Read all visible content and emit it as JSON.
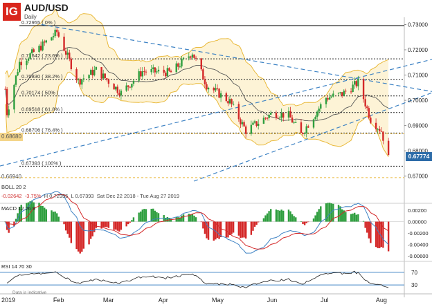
{
  "header": {
    "logo_text": "IG",
    "symbol": "AUD/USD",
    "timeframe": "Daily"
  },
  "price_axis": {
    "ticks": [
      "0.73000",
      "0.72000",
      "0.71000",
      "0.70000",
      "0.69000",
      "0.68000",
      "0.67000"
    ],
    "last_price_tag": "0.67774",
    "left_tags": [
      "0.68680",
      "0.66940"
    ]
  },
  "fib_levels": [
    {
      "label": "0.72955 ( 0% )",
      "price": 0.72955
    },
    {
      "label": "0.71642 ( 23.6% )",
      "price": 0.71642
    },
    {
      "label": "0.70830 ( 38.2% )",
      "price": 0.7083
    },
    {
      "label": "0.70174 ( 50% )",
      "price": 0.70174
    },
    {
      "label": "0.69518 ( 61.8% )",
      "price": 0.69518
    },
    {
      "label": "0.68706 ( 76.4% )",
      "price": 0.68706
    },
    {
      "label": "0.67393 ( 100% )",
      "price": 0.67393
    }
  ],
  "info_bar": {
    "boll": "BOLL 20 2",
    "change": "-0.02642",
    "change_pct": "-3.75%",
    "high": "H 0.72955",
    "low": "L 0.67393",
    "range": "Sat Dec 22 2018 - Tue Aug 27 2019"
  },
  "macd": {
    "label": "MACD 12 26 9",
    "ticks": [
      "0.00200",
      "0.00000",
      "-0.00200",
      "-0.00400",
      "-0.00600"
    ]
  },
  "rsi": {
    "label": "RSI 14 70 30",
    "ticks": [
      "70",
      "30"
    ]
  },
  "x_axis": {
    "labels": [
      "2019",
      "Feb",
      "Mar",
      "Apr",
      "May",
      "Jun",
      "Jul",
      "Aug"
    ],
    "disclaimer": "Data is indicative"
  },
  "colors": {
    "bull": "#2e9e3e",
    "bear": "#d42828",
    "trend": "#3d82c4",
    "bollinger": "#e9b93a",
    "bollinger_fill": "#fdf3d6",
    "sma": "#555555",
    "macd_line": "#3d82c4",
    "signal_line": "#d42828",
    "rsi_line": "#333333",
    "rsi_band": "#3d82c4",
    "left_tag_bg": "#f4d58a"
  },
  "chart_data": {
    "type": "candlestick",
    "title": "AUD/USD",
    "ylim": [
      0.668,
      0.7315
    ],
    "x": [
      "2019-01",
      "2019-02",
      "2019-03",
      "2019-04",
      "2019-05",
      "2019-06",
      "2019-07",
      "2019-08"
    ],
    "close_path": [
      {
        "x": "2019-01-02",
        "y": 0.7045
      },
      {
        "x": "2019-01-03",
        "y": 0.695
      },
      {
        "x": "2019-01-10",
        "y": 0.715
      },
      {
        "x": "2019-01-20",
        "y": 0.72
      },
      {
        "x": "2019-01-31",
        "y": 0.727
      },
      {
        "x": "2019-02-12",
        "y": 0.7075
      },
      {
        "x": "2019-02-22",
        "y": 0.712
      },
      {
        "x": "2019-03-08",
        "y": 0.703
      },
      {
        "x": "2019-03-20",
        "y": 0.7115
      },
      {
        "x": "2019-04-05",
        "y": 0.711
      },
      {
        "x": "2019-04-17",
        "y": 0.719
      },
      {
        "x": "2019-04-25",
        "y": 0.706
      },
      {
        "x": "2019-05-08",
        "y": 0.6995
      },
      {
        "x": "2019-05-17",
        "y": 0.688
      },
      {
        "x": "2019-06-01",
        "y": 0.695
      },
      {
        "x": "2019-06-10",
        "y": 0.694
      },
      {
        "x": "2019-06-17",
        "y": 0.6865
      },
      {
        "x": "2019-07-01",
        "y": 0.701
      },
      {
        "x": "2019-07-10",
        "y": 0.7025
      },
      {
        "x": "2019-07-19",
        "y": 0.707
      },
      {
        "x": "2019-07-26",
        "y": 0.6925
      },
      {
        "x": "2019-08-01",
        "y": 0.688
      },
      {
        "x": "2019-08-05",
        "y": 0.677
      }
    ]
  }
}
